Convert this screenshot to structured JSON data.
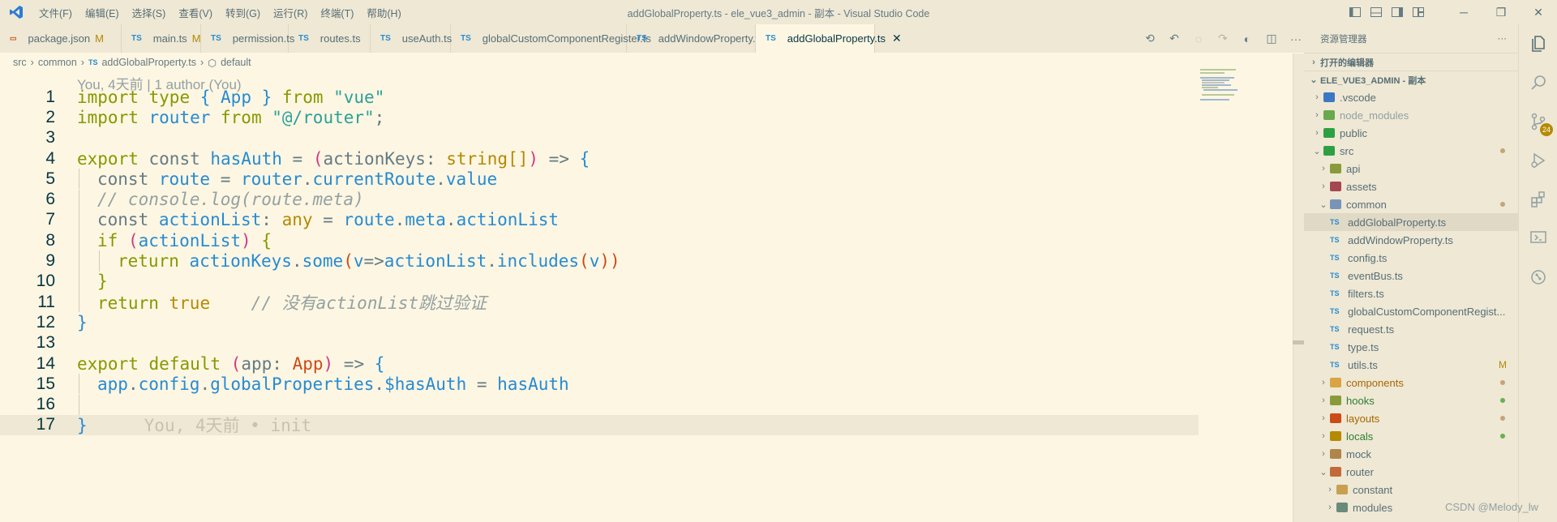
{
  "titlebar": {
    "menu": [
      "文件(F)",
      "编辑(E)",
      "选择(S)",
      "查看(V)",
      "转到(G)",
      "运行(R)",
      "终端(T)",
      "帮助(H)"
    ],
    "title": "addGlobalProperty.ts - ele_vue3_admin - 副本 - Visual Studio Code"
  },
  "tabs": [
    {
      "label": "package.json",
      "icon": "json",
      "modified": "M"
    },
    {
      "label": "main.ts",
      "icon": "TS",
      "modified": "M"
    },
    {
      "label": "permission.ts",
      "icon": "TS",
      "modified": ""
    },
    {
      "label": "routes.ts",
      "icon": "TS",
      "modified": ""
    },
    {
      "label": "useAuth.ts",
      "icon": "TS",
      "modified": ""
    },
    {
      "label": "globalCustomComponentRegister.ts",
      "icon": "TS",
      "modified": ""
    },
    {
      "label": "addWindowProperty.ts",
      "icon": "TS",
      "modified": ""
    },
    {
      "label": "addGlobalProperty.ts",
      "icon": "TS",
      "modified": "",
      "active": true
    }
  ],
  "breadcrumb": {
    "parts": [
      "src",
      "common"
    ],
    "file_icon": "TS",
    "file": "addGlobalProperty.ts",
    "symbol": "default"
  },
  "editor": {
    "blame_header": "You, 4天前 | 1 author (You)",
    "inline_blame": "You, 4天前 • init",
    "line_numbers": [
      "1",
      "2",
      "3",
      "4",
      "5",
      "6",
      "7",
      "8",
      "9",
      "10",
      "11",
      "12",
      "13",
      "14",
      "15",
      "16",
      "17"
    ],
    "lines": [
      [
        [
          "kw",
          "import "
        ],
        [
          "kw",
          "type "
        ],
        [
          "brace",
          "{ "
        ],
        [
          "var",
          "App"
        ],
        [
          "brace",
          " }"
        ],
        [
          "kw",
          " from "
        ],
        [
          "str",
          "\"vue\""
        ]
      ],
      [
        [
          "kw",
          "import "
        ],
        [
          "var",
          "router"
        ],
        [
          "kw",
          " from "
        ],
        [
          "str",
          "\"@/router\""
        ],
        [
          "plain",
          ";"
        ]
      ],
      [],
      [
        [
          "kw",
          "export "
        ],
        [
          "plain",
          "const "
        ],
        [
          "var",
          "hasAuth"
        ],
        [
          "plain",
          " = "
        ],
        [
          "paren",
          "("
        ],
        [
          "plain",
          "actionKeys"
        ],
        [
          "plain",
          ": "
        ],
        [
          "type",
          "string[]"
        ],
        [
          "paren",
          ")"
        ],
        [
          "plain",
          " => "
        ],
        [
          "brace",
          "{"
        ]
      ],
      [
        [
          "plain",
          "const "
        ],
        [
          "var",
          "route"
        ],
        [
          "plain",
          " = "
        ],
        [
          "var",
          "router"
        ],
        [
          "plain",
          "."
        ],
        [
          "var",
          "currentRoute"
        ],
        [
          "plain",
          "."
        ],
        [
          "var",
          "value"
        ]
      ],
      [
        [
          "cm",
          "// console.log(route.meta)"
        ]
      ],
      [
        [
          "plain",
          "const "
        ],
        [
          "var",
          "actionList"
        ],
        [
          "plain",
          ": "
        ],
        [
          "type",
          "any"
        ],
        [
          "plain",
          " = "
        ],
        [
          "var",
          "route"
        ],
        [
          "plain",
          "."
        ],
        [
          "var",
          "meta"
        ],
        [
          "plain",
          "."
        ],
        [
          "var",
          "actionList"
        ]
      ],
      [
        [
          "kw",
          "if "
        ],
        [
          "paren",
          "("
        ],
        [
          "var",
          "actionList"
        ],
        [
          "paren",
          ")"
        ],
        [
          "kw",
          " {"
        ]
      ],
      [
        [
          "kw",
          "return "
        ],
        [
          "var",
          "actionKeys"
        ],
        [
          "plain",
          "."
        ],
        [
          "var",
          "some"
        ],
        [
          "orange",
          "("
        ],
        [
          "var",
          "v"
        ],
        [
          "plain",
          "=>"
        ],
        [
          "var",
          "actionList"
        ],
        [
          "plain",
          "."
        ],
        [
          "var",
          "includes"
        ],
        [
          "orange",
          "("
        ],
        [
          "var",
          "v"
        ],
        [
          "orange",
          "))"
        ]
      ],
      [
        [
          "kw",
          "}"
        ]
      ],
      [
        [
          "kw",
          "return "
        ],
        [
          "bool",
          "true"
        ],
        [
          "plain",
          "    "
        ],
        [
          "cm",
          "// 没有actionList跳过验证"
        ]
      ],
      [
        [
          "brace",
          "}"
        ]
      ],
      [],
      [
        [
          "kw",
          "export "
        ],
        [
          "kw",
          "default "
        ],
        [
          "paren",
          "("
        ],
        [
          "plain",
          "app"
        ],
        [
          "plain",
          ": "
        ],
        [
          "orange",
          "App"
        ],
        [
          "paren",
          ")"
        ],
        [
          "plain",
          " => "
        ],
        [
          "brace",
          "{"
        ]
      ],
      [
        [
          "var",
          "app"
        ],
        [
          "plain",
          "."
        ],
        [
          "var",
          "config"
        ],
        [
          "plain",
          "."
        ],
        [
          "var",
          "globalProperties"
        ],
        [
          "plain",
          "."
        ],
        [
          "var",
          "$hasAuth"
        ],
        [
          "plain",
          " = "
        ],
        [
          "var",
          "hasAuth"
        ]
      ],
      [],
      [
        [
          "brace",
          "}"
        ]
      ]
    ]
  },
  "explorer": {
    "header": "资源管理器",
    "more": "···",
    "open_editors": "打开的编辑器",
    "root": "ELE_VUE3_ADMIN - 副本",
    "items": [
      {
        "name": ".vscode",
        "type": "folder",
        "color": "#3b78c4",
        "depth": 1,
        "open": false
      },
      {
        "name": "node_modules",
        "type": "folder",
        "color": "#6aa84f",
        "depth": 1,
        "open": false,
        "dim": true
      },
      {
        "name": "public",
        "type": "folder",
        "color": "#2ea043",
        "depth": 1,
        "open": false
      },
      {
        "name": "src",
        "type": "folder",
        "color": "#2ea043",
        "depth": 1,
        "open": true,
        "dot": "#c5a572"
      },
      {
        "name": "api",
        "type": "folder",
        "color": "#8a9a3a",
        "depth": 2,
        "open": false
      },
      {
        "name": "assets",
        "type": "folder",
        "color": "#a5474f",
        "depth": 2,
        "open": false
      },
      {
        "name": "common",
        "type": "folder",
        "color": "#7a94b8",
        "depth": 2,
        "open": true,
        "dot": "#c5a572"
      },
      {
        "name": "addGlobalProperty.ts",
        "type": "ts",
        "depth": 3,
        "selected": true
      },
      {
        "name": "addWindowProperty.ts",
        "type": "ts",
        "depth": 3
      },
      {
        "name": "config.ts",
        "type": "ts",
        "depth": 3
      },
      {
        "name": "eventBus.ts",
        "type": "ts",
        "depth": 3
      },
      {
        "name": "filters.ts",
        "type": "ts",
        "depth": 3
      },
      {
        "name": "globalCustomComponentRegist...",
        "type": "ts",
        "depth": 3
      },
      {
        "name": "request.ts",
        "type": "ts",
        "depth": 3
      },
      {
        "name": "type.ts",
        "type": "ts",
        "depth": 3
      },
      {
        "name": "utils.ts",
        "type": "ts",
        "depth": 3,
        "badge": "M"
      },
      {
        "name": "components",
        "type": "folder",
        "color": "#d9a441",
        "depth": 2,
        "open": false,
        "text": "orange",
        "dot": "#c5a572"
      },
      {
        "name": "hooks",
        "type": "folder",
        "color": "#8a9a3a",
        "depth": 2,
        "open": false,
        "text": "green",
        "dot": "#6ab04c"
      },
      {
        "name": "layouts",
        "type": "folder",
        "color": "#cb4b16",
        "depth": 2,
        "open": false,
        "text": "orange",
        "dot": "#c5a572"
      },
      {
        "name": "locals",
        "type": "folder",
        "color": "#b58900",
        "depth": 2,
        "open": false,
        "text": "green",
        "dot": "#6ab04c"
      },
      {
        "name": "mock",
        "type": "folder",
        "color": "#b0854a",
        "depth": 2,
        "open": false
      },
      {
        "name": "router",
        "type": "folder",
        "color": "#c26a3a",
        "depth": 2,
        "open": true
      },
      {
        "name": "constant",
        "type": "folder",
        "color": "#c9a050",
        "depth": 3,
        "open": false
      },
      {
        "name": "modules",
        "type": "folder",
        "color": "#6a8a7a",
        "depth": 3,
        "open": false
      }
    ]
  },
  "activity": {
    "scm_badge": "24"
  },
  "watermark": "CSDN @Melody_lw"
}
